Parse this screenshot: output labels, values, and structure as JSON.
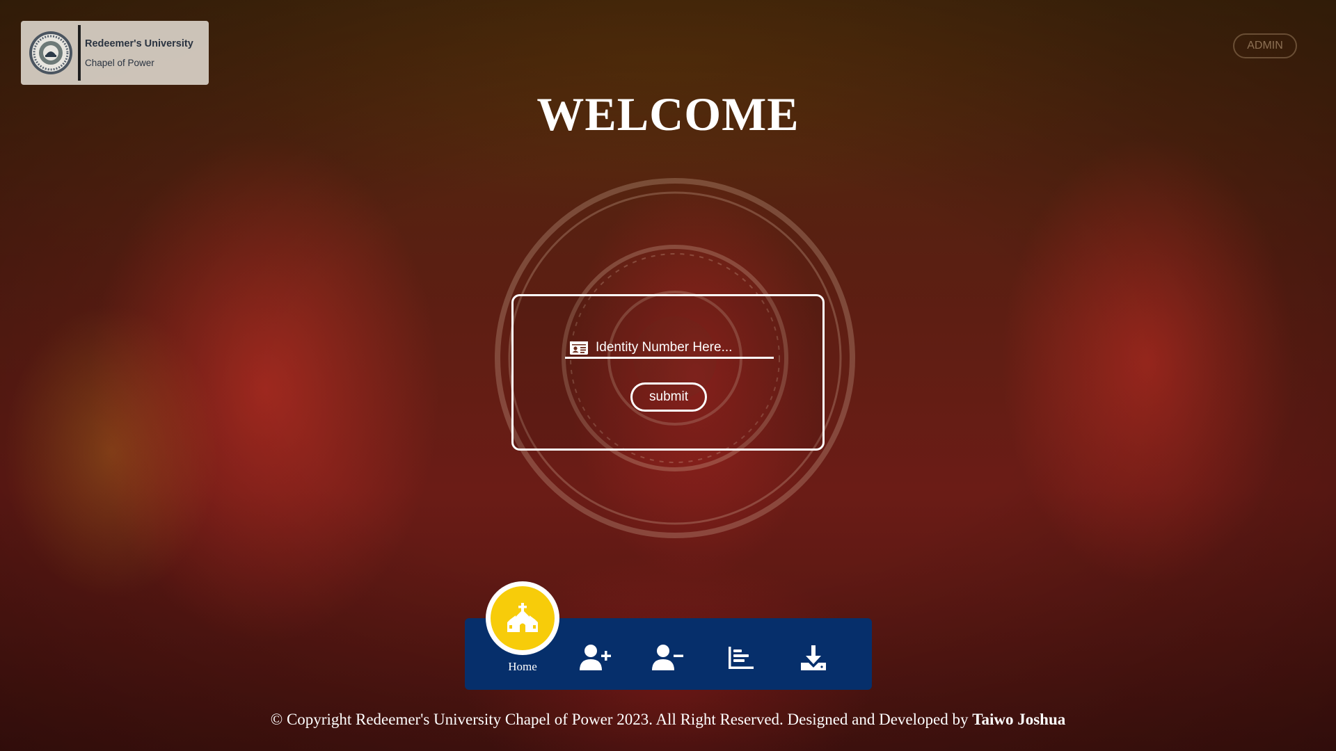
{
  "brand": {
    "name": "Redeemer's University",
    "subtitle": "Chapel of Power",
    "logo_icon": "university-seal-icon"
  },
  "admin_label": "ADMIN",
  "welcome": "WELCOME",
  "form": {
    "id_icon": "id-card-icon",
    "id_placeholder": "Identity Number Here...",
    "submit_label": "submit"
  },
  "nav": {
    "home_label": "Home",
    "home_icon": "church-icon",
    "items": [
      {
        "icon": "add-user-icon"
      },
      {
        "icon": "remove-user-icon"
      },
      {
        "icon": "bar-chart-icon"
      },
      {
        "icon": "download-icon"
      }
    ]
  },
  "footer": {
    "text": "© Copyright Redeemer's University Chapel of Power 2023. All Right Reserved. Designed and Developed by",
    "author": "Taiwo Joshua"
  },
  "colors": {
    "nav_bg": "#062f6b",
    "home_accent": "#f7cc0a",
    "text": "#ffffff"
  }
}
